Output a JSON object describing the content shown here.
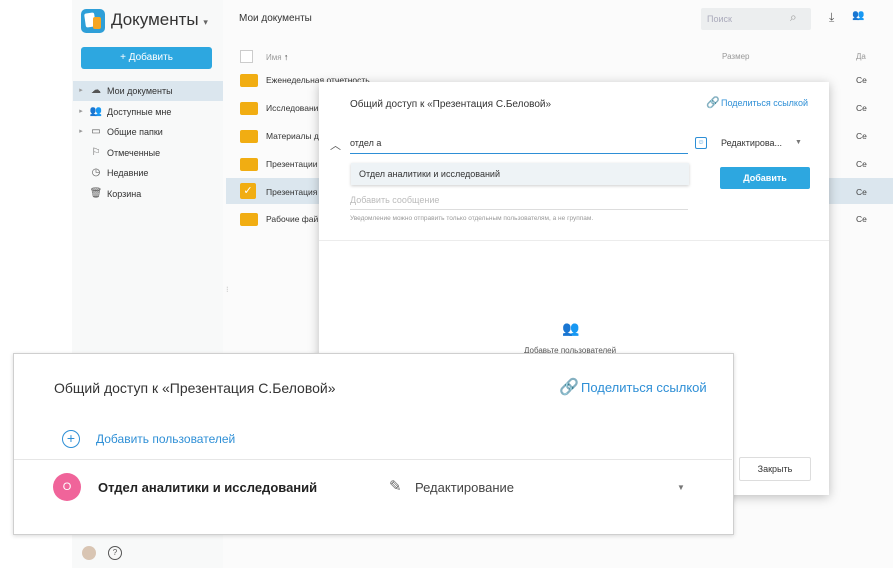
{
  "app": {
    "title": "Документы",
    "title_caret": "▾",
    "add_button": "+ Добавить"
  },
  "sidebar": {
    "items": [
      {
        "label": "Мои документы",
        "icon": "cloud-icon",
        "glyph": "☁",
        "caret": "▸",
        "active": true
      },
      {
        "label": "Доступные мне",
        "icon": "users-icon",
        "glyph": "👥",
        "caret": "▸"
      },
      {
        "label": "Общие папки",
        "icon": "folder-shared-icon",
        "glyph": "▭",
        "caret": "▸"
      },
      {
        "label": "Отмеченные",
        "icon": "flag-icon",
        "glyph": "⚐",
        "caret": ""
      },
      {
        "label": "Недавние",
        "icon": "clock-icon",
        "glyph": "◷",
        "caret": ""
      },
      {
        "label": "Корзина",
        "icon": "trash-icon",
        "glyph": "🗑",
        "caret": ""
      }
    ]
  },
  "topbar": {
    "title": "Мои документы",
    "search_placeholder": "Поиск",
    "search_icon": "⌕",
    "download_icon": "⤓",
    "users_icon": "👥"
  },
  "table": {
    "headers": {
      "name": "Имя",
      "sort_arrow": "↑",
      "size": "Размер",
      "date": "Да"
    },
    "rows": [
      {
        "name": "Еженедельная отчетность",
        "date": "Се"
      },
      {
        "name": "Исследовани",
        "date": "Се"
      },
      {
        "name": "Материалы д",
        "date": "Се"
      },
      {
        "name": "Презентации",
        "date": "Се"
      },
      {
        "name": "Презентация",
        "date": "Се",
        "selected": true
      },
      {
        "name": "Рабочие фай",
        "date": "Се"
      }
    ]
  },
  "dialog": {
    "title": "Общий доступ к «Презентация С.Беловой»",
    "share_link": "Поделиться ссылкой",
    "input_value": "отдел а",
    "permission": "Редактирова...",
    "suggestion": "Отдел аналитики и исследований",
    "add_button": "Добавить",
    "message_placeholder": "Добавить сообщение",
    "note": "Уведомление можно отправить только отдельным пользователям, а не группам.",
    "empty_text": "Добавьте пользователей",
    "close_button": "Закрыть"
  },
  "zoom": {
    "title": "Общий доступ к «Презентация С.Беловой»",
    "share_link": "Поделиться ссылкой",
    "add_users": "Добавить пользователей",
    "avatar_letter": "О",
    "member_name": "Отдел аналитики и исследований",
    "member_permission": "Редактирование"
  },
  "colors": {
    "accent": "#2da7e0",
    "link": "#2e8fd6",
    "folder": "#f1ad12",
    "avatar": "#f0649a"
  }
}
